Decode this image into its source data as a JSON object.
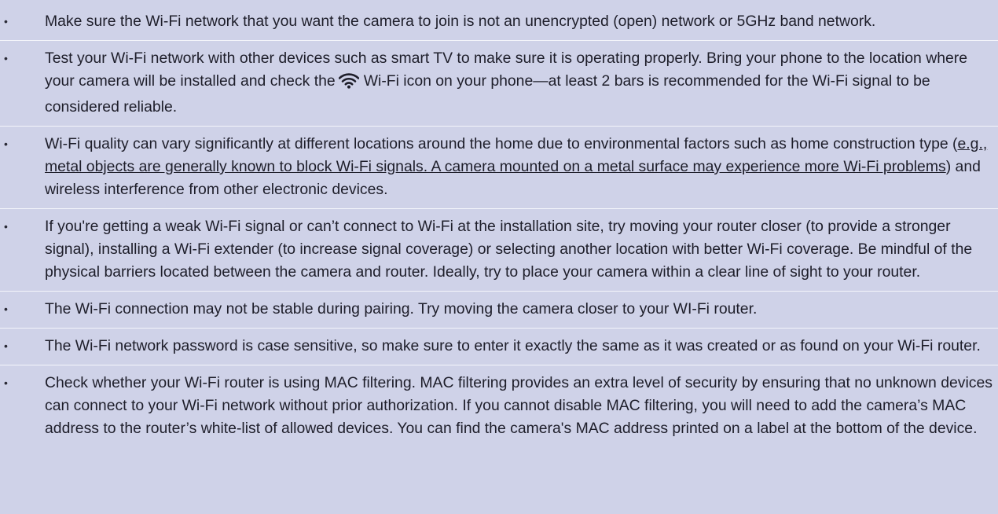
{
  "bullet_glyph": "•",
  "tips": {
    "t1": "Make sure the Wi-Fi network that you want the camera to join is not an unencrypted (open) network or 5GHz band network.",
    "t2_before_icon": "Test your Wi-Fi network with other devices such as smart TV to make sure it is operating properly. Bring your phone to the location where your camera will be installed and check the",
    "t2_after_icon": "Wi-Fi icon on your phone—at least 2 bars is recommended for the Wi-Fi signal to be considered reliable.",
    "t3_before": "Wi-Fi quality can vary significantly at different locations around the home due to environmental factors such as home construction type (",
    "t3_underlined": "e.g., metal objects are generally known to block Wi-Fi signals. A camera mounted on a metal surface may experience more Wi-Fi problems",
    "t3_after": ") and wireless interference from other electronic devices.",
    "t4": "If you're getting a weak Wi-Fi signal or can’t connect to Wi-Fi at the installation site, try moving your router closer (to provide a stronger signal), installing a Wi-Fi extender (to increase signal coverage) or selecting another location with better Wi-Fi coverage. Be mindful of the physical barriers located between the camera and router. Ideally, try to place your camera within a clear line of sight to your router.",
    "t5": "The Wi-Fi connection may not be stable during pairing. Try moving the camera closer to your WI-Fi router.",
    "t6": "The Wi-Fi network password is case sensitive, so make sure to enter it exactly the same as it was created or as found on your Wi-Fi router.",
    "t7": "Check whether your Wi-Fi router is using MAC filtering. MAC filtering provides an extra level of security by ensuring that no unknown devices can connect to your Wi-Fi network without prior authorization. If you cannot disable MAC filtering, you will need to add the camera’s MAC address to the router’s white-list of allowed devices. You can find the camera's MAC address printed on a label at the bottom of the device."
  },
  "icons": {
    "inline": "wifi-icon"
  },
  "colors": {
    "background": "#cfd2e8",
    "text": "#1e1e2a",
    "separator": "#f4f5fb"
  }
}
